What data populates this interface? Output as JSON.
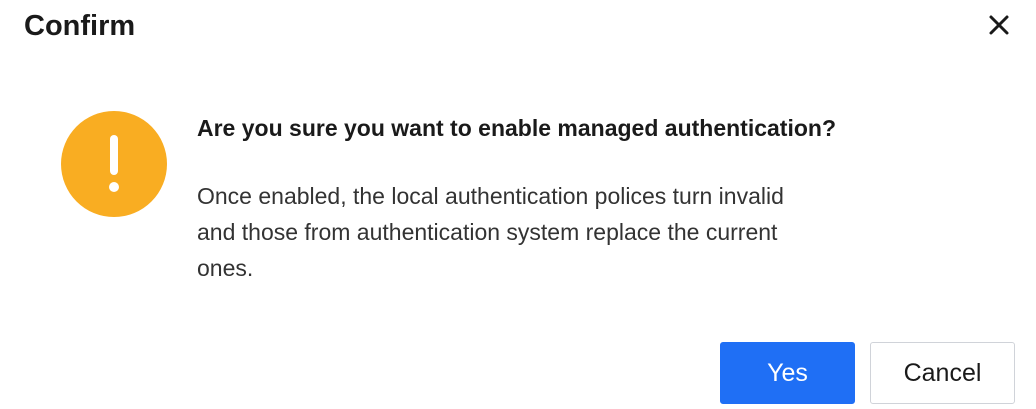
{
  "dialog": {
    "title": "Confirm",
    "close_icon": "close-icon",
    "warning_icon": "exclamation-circle-icon",
    "accent_warning": "#f9ad22",
    "heading": "Are you sure you want to enable managed authentication?",
    "body_lines": [
      "Once enabled, the local authentication polices turn invalid",
      "and those from authentication system replace the current",
      "ones."
    ],
    "buttons": {
      "yes_label": "Yes",
      "cancel_label": "Cancel",
      "primary_color": "#1f6ff5"
    }
  }
}
